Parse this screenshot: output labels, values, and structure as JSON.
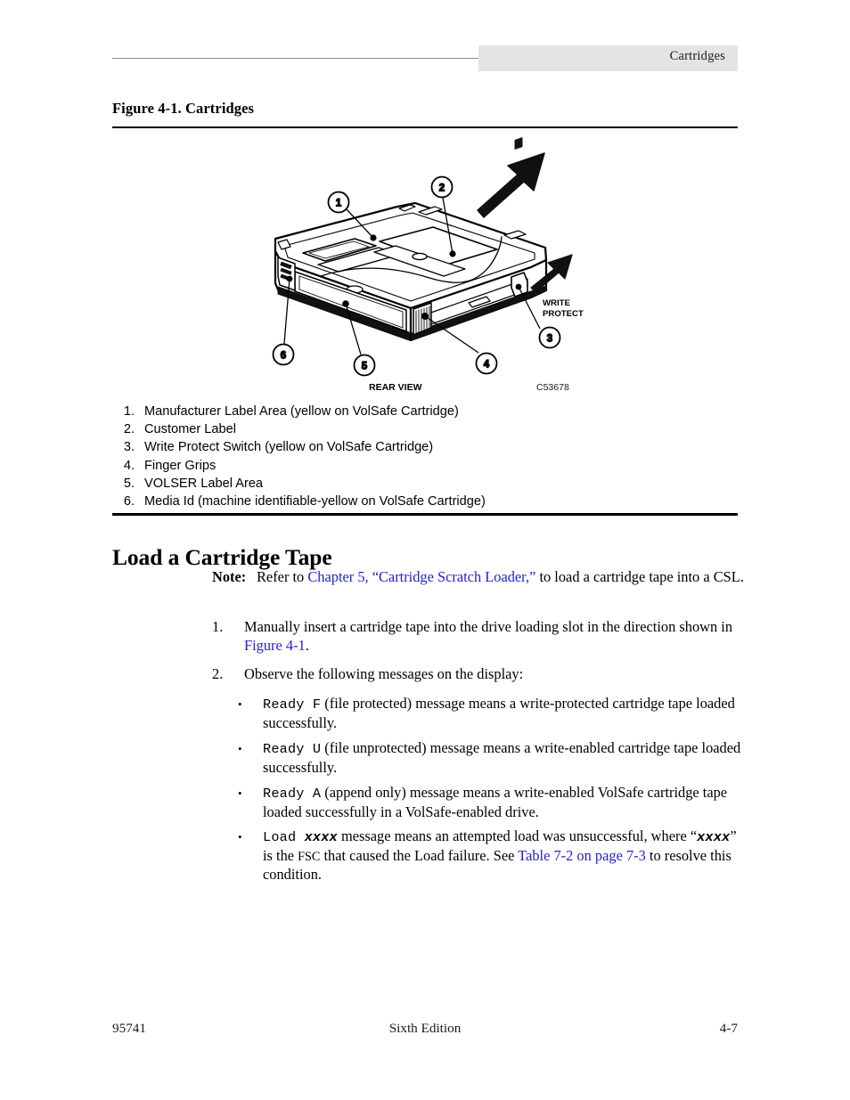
{
  "header": {
    "running_head": "Cartridges"
  },
  "figure": {
    "caption": "Figure 4-1. Cartridges",
    "view_label": "REAR VIEW",
    "drawing_id": "C53678",
    "write_protect_line1": "WRITE",
    "write_protect_line2": "PROTECT",
    "callouts": [
      "1",
      "2",
      "3",
      "4",
      "5",
      "6"
    ]
  },
  "legend": {
    "items": [
      {
        "num": "1.",
        "text": "Manufacturer Label Area (yellow on VolSafe Cartridge)"
      },
      {
        "num": "2.",
        "text": "Customer Label"
      },
      {
        "num": "3.",
        "text": "Write Protect Switch (yellow on VolSafe Cartridge)"
      },
      {
        "num": "4.",
        "text": "Finger Grips"
      },
      {
        "num": "5.",
        "text": "VOLSER Label Area"
      },
      {
        "num": "6.",
        "text": "Media Id (machine identifiable-yellow on VolSafe Cartridge)"
      }
    ]
  },
  "section": {
    "heading": "Load a Cartridge Tape"
  },
  "note": {
    "label": "Note:",
    "text_before_link": "Refer to ",
    "link": "Chapter 5, “Cartridge Scratch Loader,”",
    "text_after_link": " to load a cartridge tape into a CSL."
  },
  "steps": [
    {
      "num": "1.",
      "text_before_link": "Manually insert a cartridge tape into the drive loading slot in the direction shown in ",
      "link": "Figure 4-1",
      "text_after_link": "."
    },
    {
      "num": "2.",
      "text": "Observe the following messages on the display:"
    }
  ],
  "bullets": [
    {
      "mark": "•",
      "code": "Ready F",
      "text": " (file protected) message means a write-protected cartridge tape loaded successfully."
    },
    {
      "mark": "•",
      "code": "Ready U",
      "text": " (file unprotected) message means a write-enabled cartridge tape loaded successfully."
    },
    {
      "mark": "•",
      "code": "Ready A",
      "text": " (append only) message means a write-enabled VolSafe cartridge tape loaded successfully in a VolSafe-enabled drive."
    },
    {
      "mark": "•",
      "code": "Load ",
      "code_italic": "xxxx",
      "text_1": " message means an attempted load was unsuccessful, where “",
      "var_italic": "xxxx",
      "text_2": "” is the ",
      "abbrev": "FSC",
      "text_3": " that caused the Load failure. See ",
      "link": "Table 7-2 on page 7-3",
      "text_4": " to resolve this condition."
    }
  ],
  "footer": {
    "left": "95741",
    "center": "Sixth Edition",
    "right": "4-7"
  },
  "colors": {
    "link": "#2222cc",
    "header_band": "#e4e4e4",
    "rule": "#000000"
  }
}
